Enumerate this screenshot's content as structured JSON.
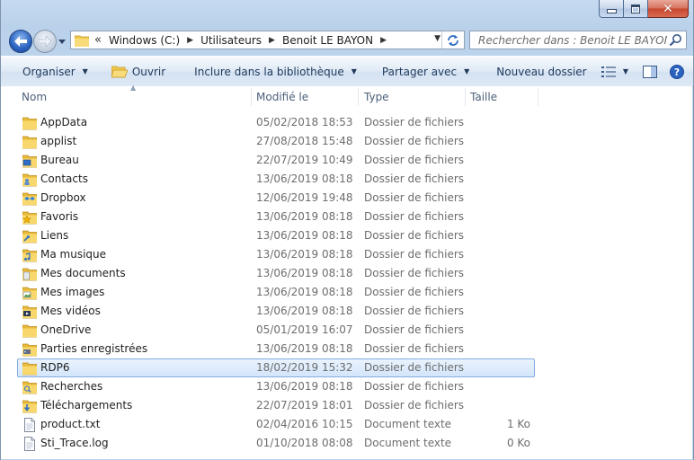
{
  "window": {
    "controls": {
      "minimize": "minimize-icon",
      "maximize": "maximize-icon",
      "close": "close-icon"
    }
  },
  "address_bar": {
    "overflow": "«",
    "crumbs": [
      "Windows (C:)",
      "Utilisateurs",
      "Benoit LE BAYON"
    ]
  },
  "search": {
    "placeholder": "Rechercher dans : Benoit LE BAYON"
  },
  "toolbar": {
    "organize": "Organiser",
    "open": "Ouvrir",
    "include_library": "Inclure dans la bibliothèque",
    "share_with": "Partager avec",
    "new_folder": "Nouveau dossier"
  },
  "columns": {
    "name": "Nom",
    "modified": "Modifié le",
    "type": "Type",
    "size": "Taille"
  },
  "files": [
    {
      "name": "AppData",
      "date": "05/02/2018 18:53",
      "type": "Dossier de fichiers",
      "size": "",
      "icon": "folder-icon"
    },
    {
      "name": "applist",
      "date": "27/08/2018 15:48",
      "type": "Dossier de fichiers",
      "size": "",
      "icon": "folder-icon"
    },
    {
      "name": "Bureau",
      "date": "22/07/2019 10:49",
      "type": "Dossier de fichiers",
      "size": "",
      "icon": "desktop-folder-icon"
    },
    {
      "name": "Contacts",
      "date": "13/06/2019 08:18",
      "type": "Dossier de fichiers",
      "size": "",
      "icon": "contacts-folder-icon"
    },
    {
      "name": "Dropbox",
      "date": "12/06/2019 19:48",
      "type": "Dossier de fichiers",
      "size": "",
      "icon": "dropbox-folder-icon"
    },
    {
      "name": "Favoris",
      "date": "13/06/2019 08:18",
      "type": "Dossier de fichiers",
      "size": "",
      "icon": "favorites-folder-icon"
    },
    {
      "name": "Liens",
      "date": "13/06/2019 08:18",
      "type": "Dossier de fichiers",
      "size": "",
      "icon": "links-folder-icon"
    },
    {
      "name": "Ma musique",
      "date": "13/06/2019 08:18",
      "type": "Dossier de fichiers",
      "size": "",
      "icon": "music-folder-icon"
    },
    {
      "name": "Mes documents",
      "date": "13/06/2019 08:18",
      "type": "Dossier de fichiers",
      "size": "",
      "icon": "documents-folder-icon"
    },
    {
      "name": "Mes images",
      "date": "13/06/2019 08:18",
      "type": "Dossier de fichiers",
      "size": "",
      "icon": "pictures-folder-icon"
    },
    {
      "name": "Mes vidéos",
      "date": "13/06/2019 08:18",
      "type": "Dossier de fichiers",
      "size": "",
      "icon": "videos-folder-icon"
    },
    {
      "name": "OneDrive",
      "date": "05/01/2019 16:07",
      "type": "Dossier de fichiers",
      "size": "",
      "icon": "folder-icon"
    },
    {
      "name": "Parties enregistrées",
      "date": "13/06/2019 08:18",
      "type": "Dossier de fichiers",
      "size": "",
      "icon": "saved-games-folder-icon"
    },
    {
      "name": "RDP6",
      "date": "18/02/2019 15:32",
      "type": "Dossier de fichiers",
      "size": "",
      "icon": "folder-icon",
      "selected": true
    },
    {
      "name": "Recherches",
      "date": "13/06/2019 08:18",
      "type": "Dossier de fichiers",
      "size": "",
      "icon": "searches-folder-icon"
    },
    {
      "name": "Téléchargements",
      "date": "22/07/2019 18:01",
      "type": "Dossier de fichiers",
      "size": "",
      "icon": "downloads-folder-icon"
    },
    {
      "name": "product.txt",
      "date": "02/04/2016 10:15",
      "type": "Document texte",
      "size": "1 Ko",
      "icon": "text-file-icon"
    },
    {
      "name": "Sti_Trace.log",
      "date": "01/10/2018 08:08",
      "type": "Document texte",
      "size": "0 Ko",
      "icon": "text-file-icon"
    }
  ],
  "colors": {
    "selection_border": "#84acdd",
    "selection_fill": "#d3e5fb",
    "folder_yellow": "#f2c94c",
    "toolbar_text": "#1e395b"
  }
}
